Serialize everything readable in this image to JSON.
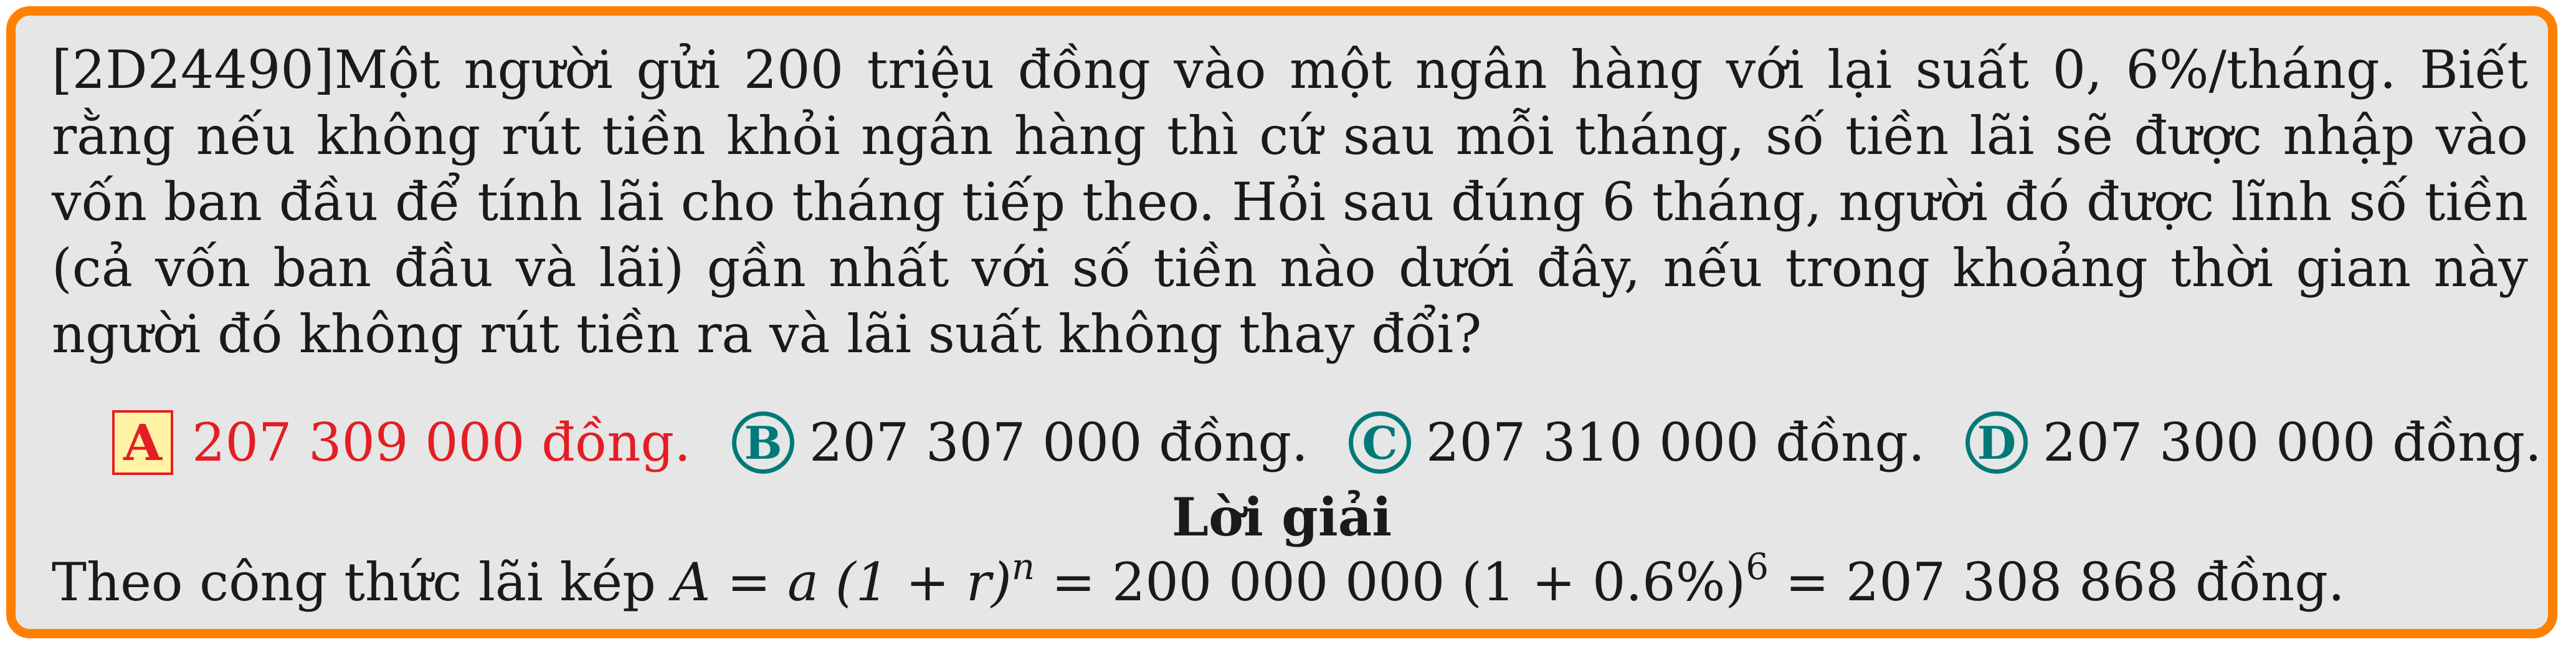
{
  "problem": {
    "id": "[2D24490]",
    "text": "Một người gửi 200 triệu đồng vào một ngân hàng với lại suất 0, 6%/tháng. Biết rằng nếu không rút tiền khỏi ngân hàng thì cứ sau mỗi tháng, số tiền lãi sẽ được nhập vào vốn ban đầu để tính lãi cho tháng tiếp theo. Hỏi sau đúng 6 tháng, người đó được lĩnh số tiền (cả vốn ban đầu và lãi) gần nhất với số tiền nào dưới đây, nếu trong khoảng thời gian này người đó không rút tiền ra và lãi suất không thay đổi?"
  },
  "choices": [
    {
      "letter": "A",
      "text": "207 309 000 đồng.",
      "correct": true
    },
    {
      "letter": "B",
      "text": "207 307 000 đồng.",
      "correct": false
    },
    {
      "letter": "C",
      "text": "207 310 000 đồng.",
      "correct": false
    },
    {
      "letter": "D",
      "text": "207 300 000 đồng.",
      "correct": false
    }
  ],
  "solution": {
    "title": "Lời giải",
    "prefix": "Theo công thức lãi kép",
    "formula_lhs": "A = a (1 + r)",
    "exponent_n": "n",
    "formula_mid": " = 200 000 000 (1 + 0.6%)",
    "exponent_6": "6",
    "formula_rhs": " = 207 308 868 đồng."
  },
  "colors": {
    "frame": "#ff8000",
    "background": "#e6e6e6",
    "correct": "#e31e24",
    "highlight": "#fff3a6",
    "choice_circle": "#007a78"
  }
}
